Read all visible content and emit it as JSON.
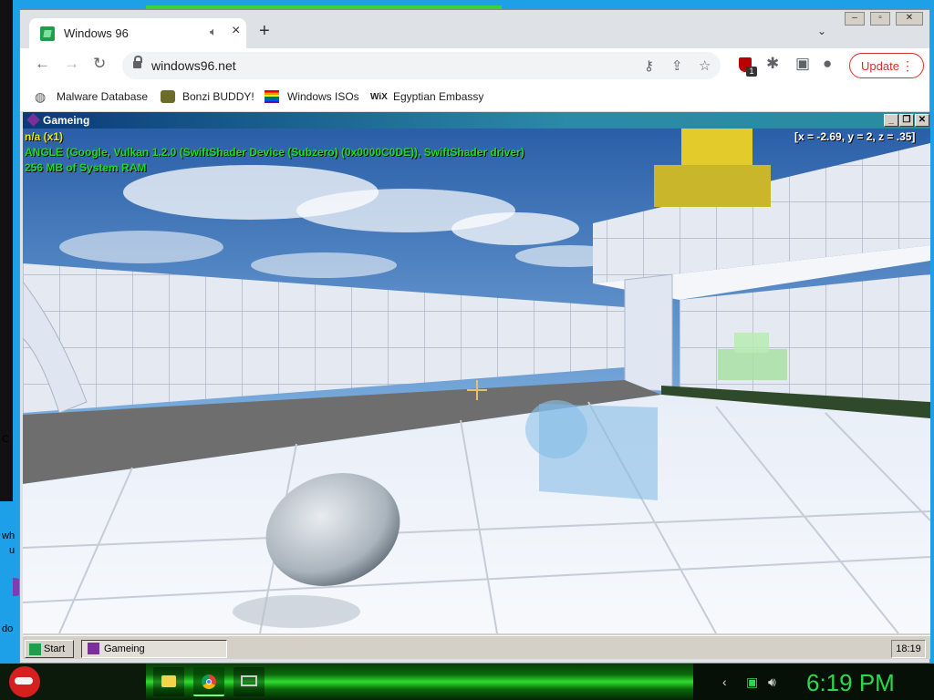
{
  "browser": {
    "tab": {
      "title": "Windows 96",
      "close_icon": "close-icon",
      "audio_icon": "speaker-icon"
    },
    "new_tab_label": "+",
    "window_controls": [
      "minimize",
      "restore",
      "close"
    ],
    "address": {
      "url": "windows96.net"
    },
    "update_label": "Update",
    "extension_badge": "1",
    "bookmarks": [
      {
        "label": "Malware Database",
        "icon": "globe-icon"
      },
      {
        "label": "Bonzi BUDDY!",
        "icon": "gorilla-icon"
      },
      {
        "label": "Windows ISOs",
        "icon": "rainbow-flag-icon"
      },
      {
        "label": "Egyptian Embassy",
        "icon": "wix-icon",
        "icon_text": "WiX"
      }
    ]
  },
  "app": {
    "title": "Gameing",
    "hud": {
      "line1": "n/a (x1)",
      "line2": "ANGLE (Google, Vulkan 1.2.0 (SwiftShader Device (Subzero) (0x0000C0DE)), SwiftShader driver)",
      "line3": "256 MB of System RAM",
      "coords": "[x = -2.69, y = 2, z = .35]"
    },
    "colors": {
      "hud_green": "#1cdc1c",
      "hud_yellow": "#e8e800",
      "title_blue": "#0a3a78"
    }
  },
  "w96_taskbar": {
    "start_label": "Start",
    "task_label": "Gameing",
    "clock": "18:19"
  },
  "desktop": {
    "fragments": [
      "C",
      "wh",
      "u",
      "do"
    ]
  },
  "host_taskbar": {
    "clock": "6:19 PM",
    "apps": [
      "folder-icon",
      "chrome-icon",
      "remote-desktop-icon"
    ],
    "tray": [
      "chevron-left-icon",
      "battery-icon",
      "volume-icon"
    ]
  }
}
